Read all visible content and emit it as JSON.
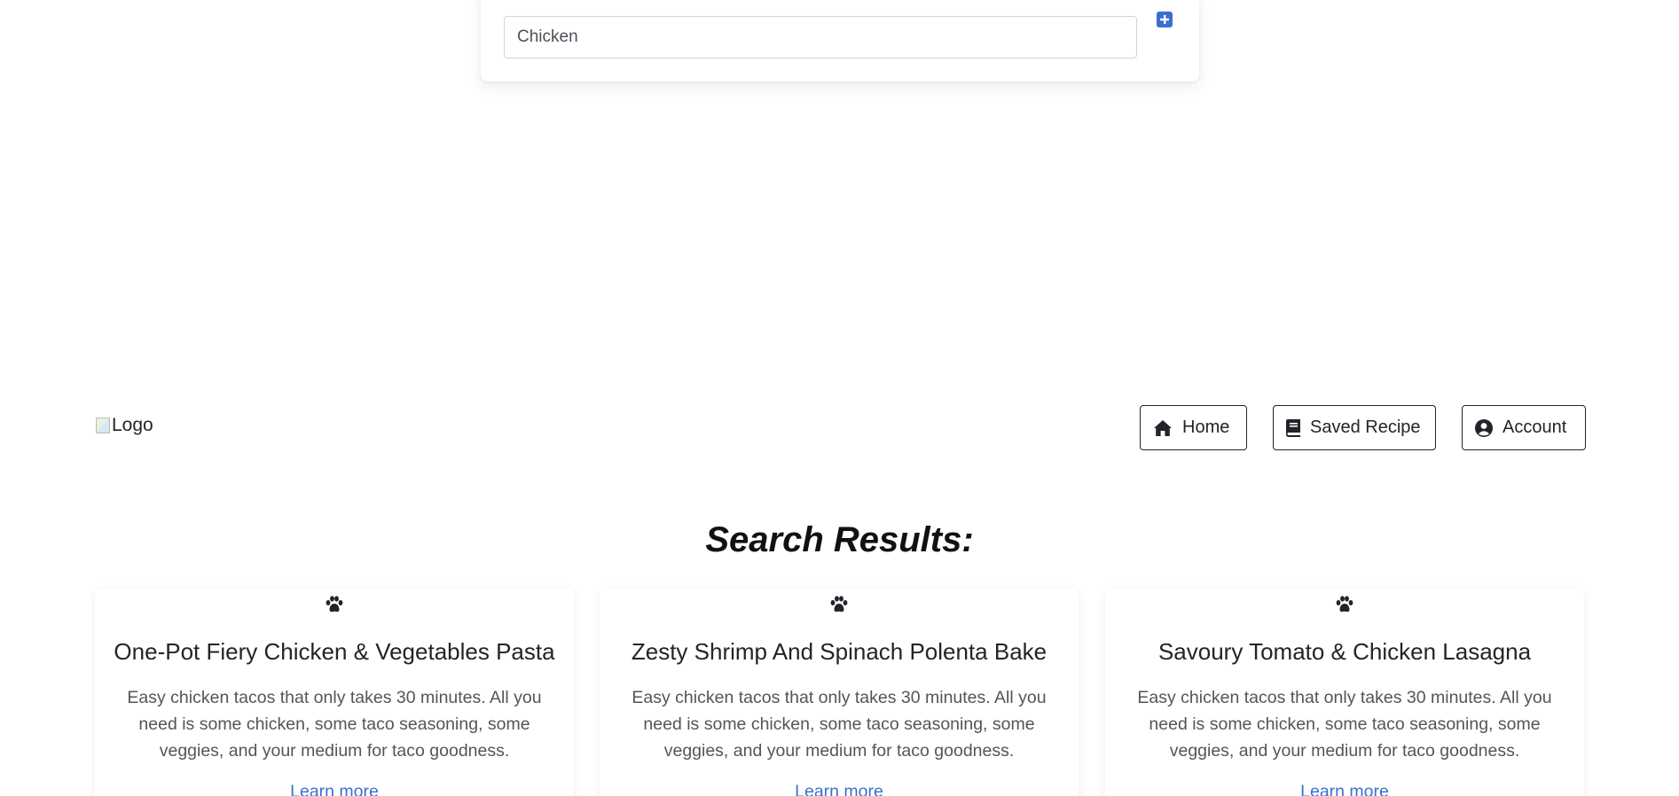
{
  "search": {
    "value": "Chicken",
    "add_icon": "plus-square-icon",
    "accent": "#3b6fcf"
  },
  "nav": {
    "logo_alt": "Logo",
    "home_label": "Home",
    "home_icon": "home-icon",
    "saved_label": "Saved Recipe",
    "saved_icon": "book-icon",
    "account_label": "Account",
    "account_icon": "user-circle-icon"
  },
  "results": {
    "heading": "Search Results:",
    "cards": [
      {
        "icon": "paw-icon",
        "title": "One-Pot Fiery Chicken & Vegetables Pasta",
        "description": "Easy chicken tacos that only takes 30 minutes. All you need is some chicken, some taco seasoning, some veggies, and your medium for taco goodness.",
        "link": "Learn more"
      },
      {
        "icon": "paw-icon",
        "title": "Zesty Shrimp And Spinach Polenta Bake",
        "description": "Easy chicken tacos that only takes 30 minutes. All you need is some chicken, some taco seasoning, some veggies, and your medium for taco goodness.",
        "link": "Learn more"
      },
      {
        "icon": "paw-icon",
        "title": "Savoury Tomato & Chicken Lasagna",
        "description": "Easy chicken tacos that only takes 30 minutes. All you need is some chicken, some taco seasoning, some veggies, and your medium for taco goodness.",
        "link": "Learn more"
      }
    ]
  }
}
